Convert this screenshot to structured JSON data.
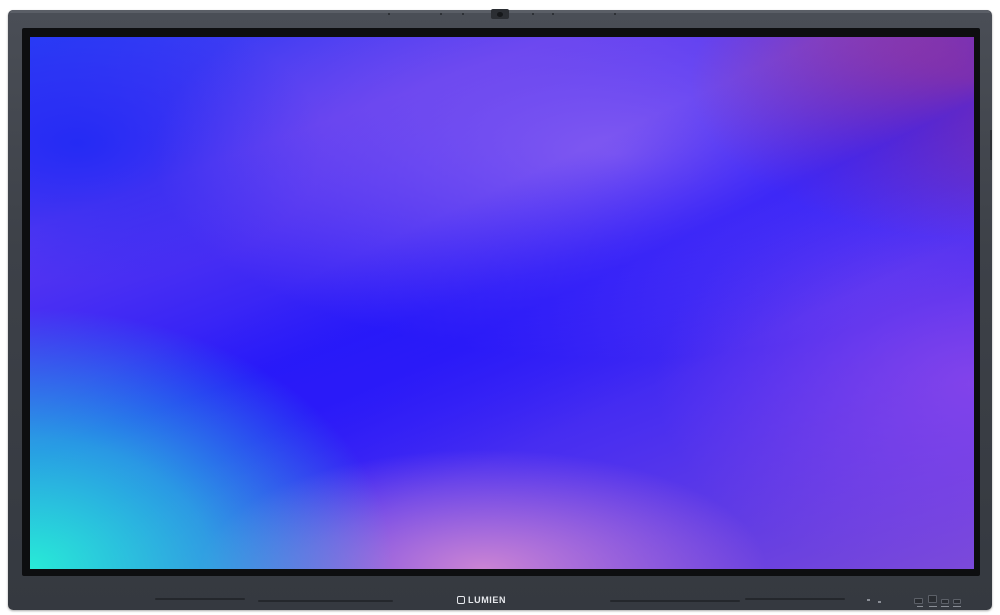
{
  "device": {
    "brand_label": "LUMIEN"
  },
  "screen": {
    "wallpaper": "abstract-gradient",
    "colors": {
      "cyan": "#28ebd7",
      "deep_blue": "#2a1cf8",
      "purple": "#8c62f0",
      "pink": "#d78cd2",
      "red": "#c8466e"
    }
  },
  "icons": {
    "camera": "camera-icon",
    "logo": "lumien-logo-mark"
  }
}
